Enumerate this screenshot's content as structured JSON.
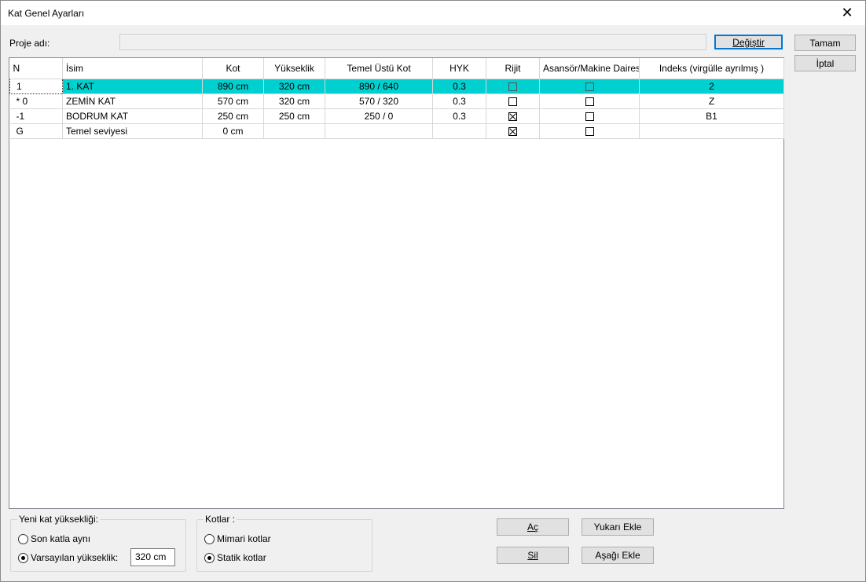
{
  "window": {
    "title": "Kat Genel Ayarları",
    "close_symbol": "✕"
  },
  "project": {
    "label": "Proje adı:",
    "value": "",
    "change_label": "Değiştir"
  },
  "actions": {
    "ok_label": "Tamam",
    "cancel_label": "İptal"
  },
  "table": {
    "headers": [
      "N",
      "İsim",
      "Kot",
      "Yükseklik",
      "Temel Üstü Kot",
      "HYK",
      "Rijit",
      "Asansör/Makine Dairesi",
      "Indeks (virgülle ayrılmış )"
    ],
    "rows": [
      {
        "n": "1",
        "name": "1. KAT",
        "kot": "890 cm",
        "height": "320 cm",
        "temel": "890 / 640",
        "hyk": "0.3",
        "rigid": false,
        "elevator": false,
        "index": "2",
        "selected": true
      },
      {
        "n": "* 0",
        "name": "ZEMİN KAT",
        "kot": "570 cm",
        "height": "320 cm",
        "temel": "570 / 320",
        "hyk": "0.3",
        "rigid": false,
        "elevator": false,
        "index": "Z",
        "selected": false
      },
      {
        "n": "-1",
        "name": "BODRUM KAT",
        "kot": "250 cm",
        "height": "250 cm",
        "temel": "250 / 0",
        "hyk": "0.3",
        "rigid": true,
        "elevator": false,
        "index": "B1",
        "selected": false
      },
      {
        "n": "G",
        "name": "Temel seviyesi",
        "kot": "0 cm",
        "height": "",
        "temel": "",
        "hyk": "",
        "rigid": true,
        "elevator": false,
        "index": "",
        "selected": false
      }
    ]
  },
  "new_floor": {
    "legend": "Yeni kat yüksekliği:",
    "option_same": "Son katla aynı",
    "option_default": "Varsayılan yükseklik:",
    "default_value": "320 cm",
    "selected": "default"
  },
  "levels": {
    "legend": "Kotlar :",
    "option_arch": "Mimari kotlar",
    "option_static": "Statik kotlar",
    "selected": "static"
  },
  "bottom_buttons": {
    "open": "Aç",
    "delete": "Sil",
    "add_above": "Yukarı Ekle",
    "add_below": "Aşağı Ekle"
  }
}
